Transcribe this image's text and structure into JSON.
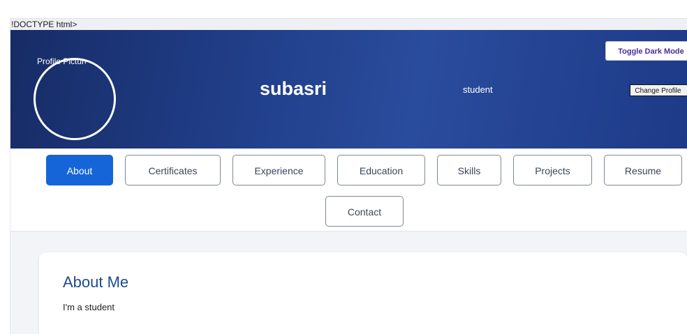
{
  "doctype_text": "!DOCTYPE html>",
  "header": {
    "avatar_alt": "Profile Picture",
    "name": "subasri",
    "role": "student",
    "toggle_dark_mode_label": "Toggle Dark Mode",
    "change_profile_label": "Change Profile"
  },
  "nav": {
    "tabs": [
      {
        "label": "About",
        "active": true
      },
      {
        "label": "Certificates",
        "active": false
      },
      {
        "label": "Experience",
        "active": false
      },
      {
        "label": "Education",
        "active": false
      },
      {
        "label": "Skills",
        "active": false
      },
      {
        "label": "Projects",
        "active": false
      },
      {
        "label": "Resume",
        "active": false
      },
      {
        "label": "Contact",
        "active": false
      }
    ]
  },
  "about": {
    "title": "About Me",
    "text": "I'm a student"
  },
  "colors": {
    "header_gradient_start": "#172c66",
    "header_gradient_end": "#2a4c9c",
    "active_tab": "#1565d8",
    "tab_border": "#7c8799",
    "toggle_text": "#4d2a9a",
    "card_title": "#1f4a8e",
    "content_background": "#f3f4f7"
  }
}
